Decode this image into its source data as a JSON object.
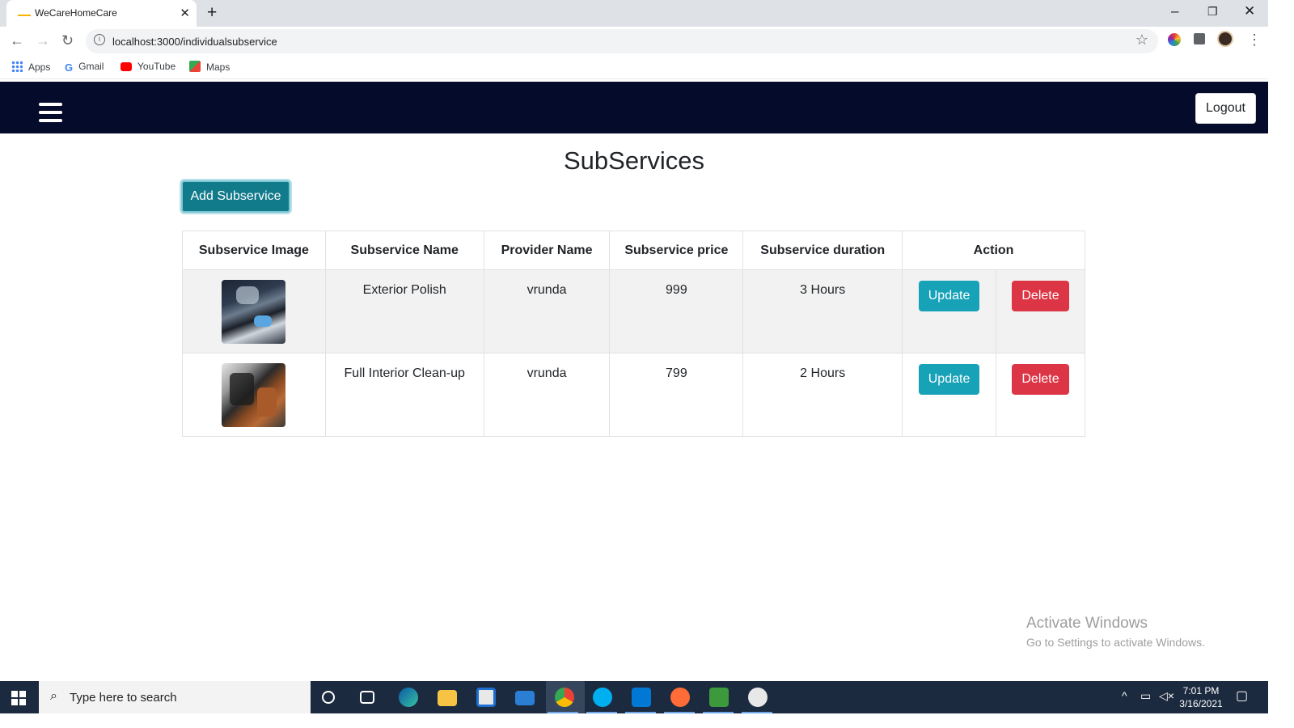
{
  "browser": {
    "tab_title": "WeCareHomeCare",
    "url": "localhost:3000/individualsubservice",
    "bookmarks": [
      "Apps",
      "Gmail",
      "YouTube",
      "Maps"
    ]
  },
  "navbar": {
    "logout_label": "Logout"
  },
  "page": {
    "title": "SubServices",
    "add_button": "Add Subservice"
  },
  "table": {
    "headers": [
      "Subservice Image",
      "Subservice Name",
      "Provider Name",
      "Subservice price",
      "Subservice duration",
      "Action"
    ],
    "rows": [
      {
        "name": "Exterior Polish",
        "provider": "vrunda",
        "price": "999",
        "duration": "3 Hours",
        "update": "Update",
        "delete": "Delete"
      },
      {
        "name": "Full Interior Clean-up",
        "provider": "vrunda",
        "price": "799",
        "duration": "2 Hours",
        "update": "Update",
        "delete": "Delete"
      }
    ]
  },
  "watermark": {
    "line1": "Activate Windows",
    "line2": "Go to Settings to activate Windows."
  },
  "taskbar": {
    "search_placeholder": "Type here to search",
    "time": "7:01 PM",
    "date": "3/16/2021"
  },
  "colors": {
    "navbar": "#050b2b",
    "update": "#17a2b8",
    "delete": "#dc3545",
    "add": "#117a8b"
  }
}
